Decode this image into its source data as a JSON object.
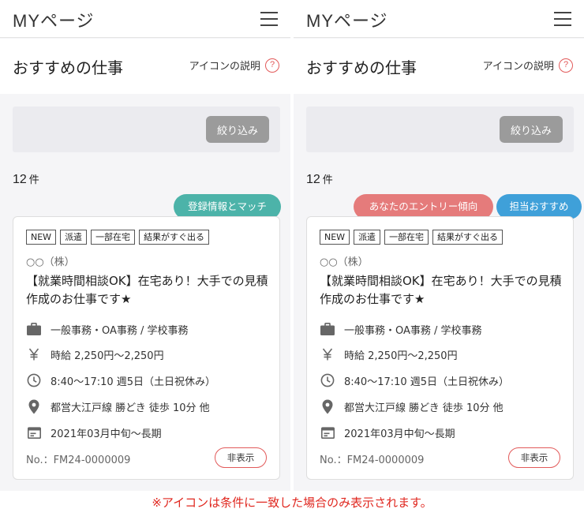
{
  "header": {
    "title": "MYページ"
  },
  "section": {
    "title": "おすすめの仕事",
    "icon_help_label": "アイコンの説明",
    "help_symbol": "?"
  },
  "filter": {
    "button_label": "絞り込み"
  },
  "results": {
    "count": "12",
    "unit": "件"
  },
  "job": {
    "tags": [
      "NEW",
      "派遣",
      "一部在宅",
      "結果がすぐ出る"
    ],
    "company": "○○（株）",
    "title": "【就業時間相談OK】在宅あり！大手での見積作成のお仕事です★",
    "job_type": "一般事務・OA事務 / 学校事務",
    "salary": "時給 2,250円〜2,250円",
    "hours": "8:40〜17:10 週5日（土日祝休み）",
    "access": "都営大江戸線 勝どき 徒歩 10分 他",
    "period": "2021年03月中旬〜長期",
    "number": "No.：FM24-0000009",
    "hide_label": "非表示"
  },
  "badges": {
    "left": [
      {
        "label": "登録情報とマッチ",
        "color": "#4cb3a9"
      }
    ],
    "right": [
      {
        "label": "あなたのエントリー傾向",
        "color": "#e57b7b"
      },
      {
        "label": "担当おすすめ",
        "color": "#3fa0d9"
      }
    ]
  },
  "icons": [
    "briefcase-icon",
    "yen-icon",
    "clock-icon",
    "location-pin-icon",
    "calendar-icon",
    "help-circle-icon",
    "hamburger-menu-icon"
  ],
  "footnote": "※アイコンは条件に一致した場合のみ表示されます。",
  "colors": {
    "accent_red": "#e25a5a",
    "footnote_red": "#e0271f",
    "filter_button": "#9b9b9b"
  }
}
